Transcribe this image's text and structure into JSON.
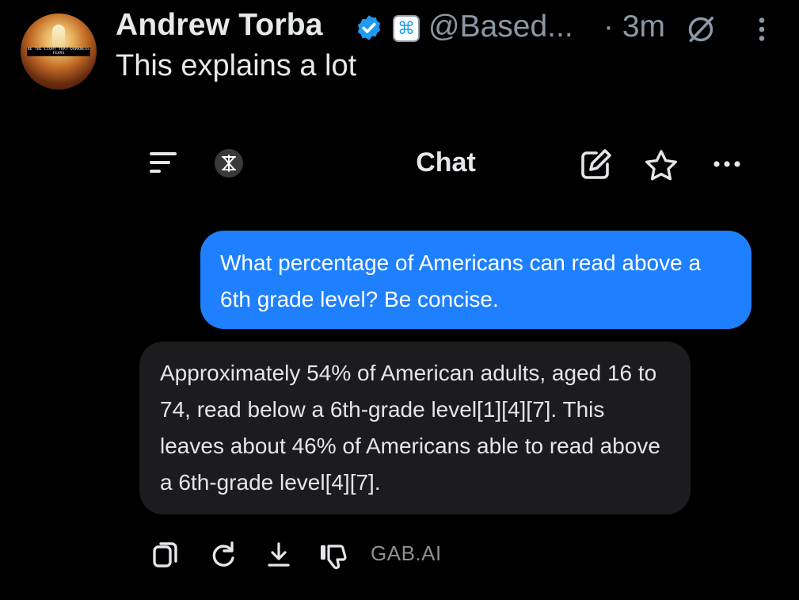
{
  "post": {
    "author_name": "Andrew Torba",
    "handle": "@Based...",
    "time": "· 3m",
    "text": "This explains a lot",
    "avatar_text": "BE THE LIGHT THAT DARKNESS FEARS",
    "icons": {
      "verified": "verified-badge-icon",
      "affiliate": "affiliate-badge-icon",
      "grok": "grok-icon",
      "more": "kebab-menu-icon"
    },
    "accent_color": "#1d9bf0"
  },
  "chat": {
    "title": "Chat",
    "user_message": "What percentage of Americans can read above a 6th grade level? Be concise.",
    "ai_message": "Approximately 54% of American adults, aged 16 to 74, read below a 6th-grade level[1][4][7]. This leaves about 46% of Americans able to read above a 6th-grade level[4][7].",
    "brand_label": "GAB.AI",
    "user_bubble_color": "#1e80ff",
    "ai_bubble_color": "#1c1c1e",
    "header_icons": [
      "menu-icon",
      "app-logo-icon",
      "edit-icon",
      "star-icon",
      "more-icon"
    ],
    "action_icons": [
      "copy-icon",
      "regenerate-icon",
      "download-icon",
      "dislike-icon"
    ]
  }
}
